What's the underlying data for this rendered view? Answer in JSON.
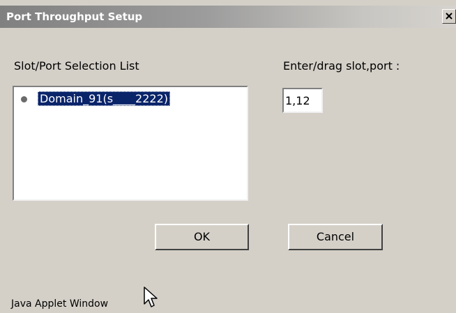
{
  "window": {
    "title": "Port Throughput Setup",
    "close_glyph": "×",
    "close_icon": "close-icon",
    "background": "#d4d0c8"
  },
  "selection_list": {
    "label": "Slot/Port Selection List",
    "items": [
      {
        "text": "Domain_91(s____2222)",
        "selected": true
      }
    ],
    "selection_color": "#0a246a"
  },
  "slot_port_entry": {
    "label": "Enter/drag slot,port :",
    "value": "1,12"
  },
  "buttons": {
    "ok_label": "OK",
    "cancel_label": "Cancel"
  },
  "status_bar": {
    "text": "Java Applet Window"
  },
  "cursor_icon": "mouse-pointer-icon"
}
